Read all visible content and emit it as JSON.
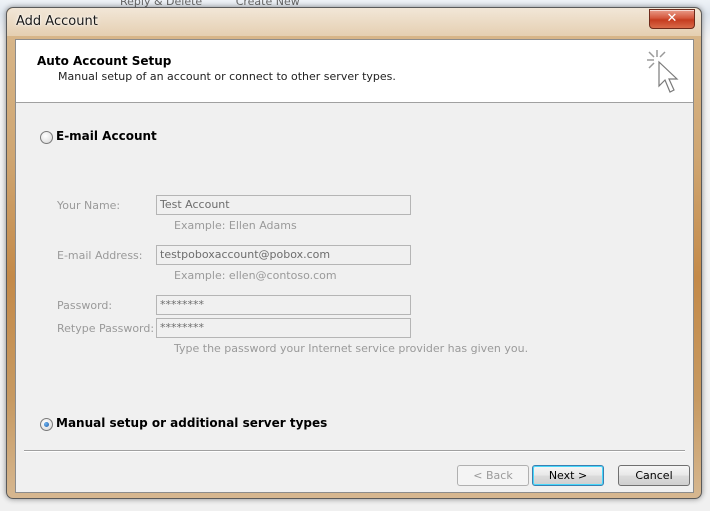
{
  "background": {
    "toolbar_items": [
      "Reply & Delete",
      "Create New"
    ]
  },
  "dialog": {
    "title": "Add Account",
    "close_label": "✕"
  },
  "header": {
    "title": "Auto Account Setup",
    "subtitle": "Manual setup of an account or connect to other server types.",
    "icon": "cursor-click-icon"
  },
  "options": {
    "email_account": {
      "label": "E-mail Account",
      "checked": false
    },
    "manual_setup": {
      "label": "Manual setup or additional server types",
      "checked": true
    }
  },
  "form": {
    "name": {
      "label": "Your Name:",
      "value": "Test Account",
      "example": "Example: Ellen Adams"
    },
    "email": {
      "label": "E-mail Address:",
      "value": "testpoboxaccount@pobox.com",
      "example": "Example: ellen@contoso.com"
    },
    "password": {
      "label": "Password:",
      "value": "********"
    },
    "retype_password": {
      "label": "Retype Password:",
      "value": "********"
    },
    "password_hint": "Type the password your Internet service provider has given you."
  },
  "buttons": {
    "back": "< Back",
    "next": "Next >",
    "cancel": "Cancel"
  },
  "colors": {
    "frame_accent": "#c48a49",
    "radio_dot": "#1a5aa8"
  }
}
